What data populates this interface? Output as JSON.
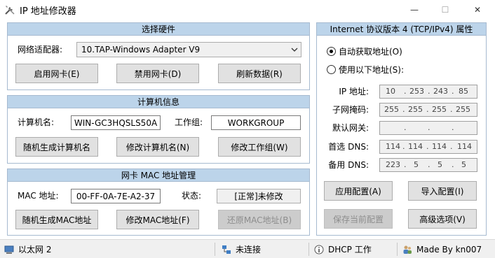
{
  "window": {
    "title": "IP 地址修改器",
    "minimize_glyph": "—",
    "maximize_glyph": "☐",
    "close_glyph": "✕"
  },
  "hardware": {
    "header": "选择硬件",
    "adapter_label": "网络适配器:",
    "adapter_value": "10.TAP-Windows Adapter V9",
    "enable_btn": "启用网卡(E)",
    "disable_btn": "禁用网卡(D)",
    "refresh_btn": "刷新数据(R)"
  },
  "computer": {
    "header": "计算机信息",
    "name_label": "计算机名:",
    "name_value": "WIN-GC3HQSLS50A",
    "workgroup_label": "工作组:",
    "workgroup_value": "WORKGROUP",
    "random_name_btn": "随机生成计算机名",
    "modify_name_btn": "修改计算机名(N)",
    "modify_workgroup_btn": "修改工作组(W)"
  },
  "mac": {
    "header": "网卡 MAC 地址管理",
    "mac_label": "MAC 地址:",
    "mac_value": "00-FF-0A-7E-A2-37",
    "status_label": "状态:",
    "status_value": "[正常]未修改",
    "random_mac_btn": "随机生成MAC地址",
    "modify_mac_btn": "修改MAC地址(F)",
    "restore_mac_btn": "还原MAC地址(B)"
  },
  "ipv4": {
    "header": "Internet 协议版本 4 (TCP/IPv4) 属性",
    "auto_radio": "自动获取地址(O)",
    "manual_radio": "使用以下地址(S):",
    "ip_label": "IP 地址:",
    "ip": [
      "10",
      "253",
      "243",
      "85"
    ],
    "mask_label": "子网掩码:",
    "mask": [
      "255",
      "255",
      "255",
      "255"
    ],
    "gateway_label": "默认网关:",
    "gateway": [
      "",
      "",
      "",
      ""
    ],
    "dns1_label": "首选 DNS:",
    "dns1": [
      "114",
      "114",
      "114",
      "114"
    ],
    "dns2_label": "备用 DNS:",
    "dns2": [
      "223",
      "5",
      "5",
      "5"
    ],
    "apply_btn": "应用配置(A)",
    "import_btn": "导入配置(I)",
    "save_btn": "保存当前配置",
    "advanced_btn": "高级选项(V)",
    "dot": "."
  },
  "status": {
    "network": "以太网 2",
    "connection": "未连接",
    "dhcp": "DHCP 工作",
    "author": "Made By kn007"
  },
  "colors": {
    "group_header_bg": "#bcd4ea",
    "group_border": "#a6bad0",
    "button_bg": "#e1e1e1"
  },
  "icons": {
    "app": "tools-icon",
    "network": "network-computer-icon",
    "connection": "network-cable-icon",
    "dhcp": "info-icon",
    "author": "users-icon"
  }
}
